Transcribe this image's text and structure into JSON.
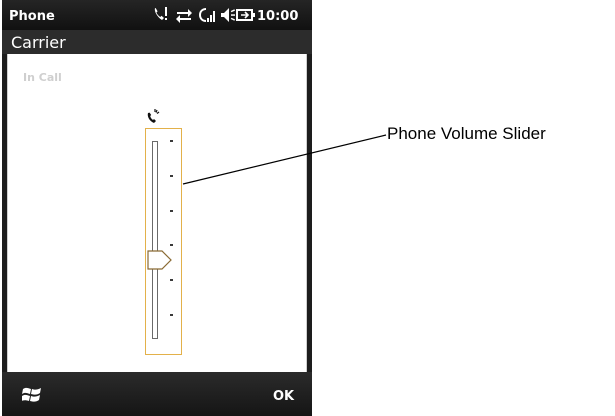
{
  "status_bar": {
    "app_title": "Phone",
    "time": "10:00",
    "icons": [
      "missed-call-icon",
      "data-connection-icon",
      "signal-strength-icon",
      "speaker-volume-icon",
      "battery-icon"
    ]
  },
  "carrier": {
    "name": "Carrier"
  },
  "call": {
    "status": "In Call",
    "volume_icon": "phone-volume-icon",
    "volume_level": 0.4,
    "tick_count": 6
  },
  "softkeys": {
    "left_icon": "windows-start-icon",
    "right_label": "OK"
  },
  "callout": {
    "label": "Phone Volume Slider"
  },
  "colors": {
    "focus_outline": "#e3b14a",
    "bar_background": "#1d1d1d",
    "carrier_background": "#2c2c2c"
  }
}
